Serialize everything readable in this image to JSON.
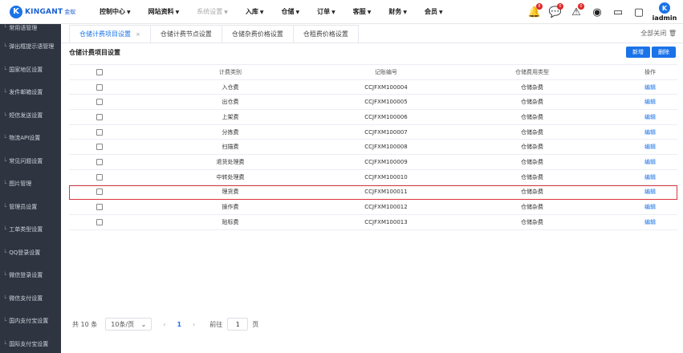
{
  "brand": {
    "mark": "K",
    "name": "KINGANT",
    "sub": "金蚁"
  },
  "menu": [
    {
      "label": "控制中心",
      "disabled": false
    },
    {
      "label": "网站资料",
      "disabled": false
    },
    {
      "label": "系统设置",
      "disabled": true
    },
    {
      "label": "入库",
      "disabled": false
    },
    {
      "label": "仓储",
      "disabled": false
    },
    {
      "label": "订单",
      "disabled": false
    },
    {
      "label": "客服",
      "disabled": false
    },
    {
      "label": "财务",
      "disabled": false
    },
    {
      "label": "会员",
      "disabled": false
    }
  ],
  "top_icons": [
    {
      "name": "bell-icon",
      "glyph": "🔔",
      "badge": "8"
    },
    {
      "name": "message-icon",
      "glyph": "💬",
      "badge": "0"
    },
    {
      "name": "alert-icon",
      "glyph": "⚠",
      "badge": "0"
    },
    {
      "name": "support-icon",
      "glyph": "◉",
      "badge": ""
    },
    {
      "name": "monitor-icon",
      "glyph": "▭",
      "badge": ""
    },
    {
      "name": "chat-icon",
      "glyph": "▢",
      "badge": ""
    }
  ],
  "user": {
    "avatar": "K",
    "name": "iadmin"
  },
  "sidebar": [
    "常用语管理",
    "弹出框提示语管理",
    "国家地区设置",
    "发件邮箱设置",
    "短信发送设置",
    "物流API设置",
    "常见问题设置",
    "图片管理",
    "管理员设置",
    "工单类型设置",
    "QQ登录设置",
    "微信登录设置",
    "微信支付设置",
    "国内支付宝设置",
    "国际支付宝设置"
  ],
  "tabs": [
    {
      "label": "仓储计费项目设置",
      "active": true,
      "closable": true
    },
    {
      "label": "仓储计费节点设置",
      "active": false,
      "closable": false
    },
    {
      "label": "仓储杂费价格设置",
      "active": false,
      "closable": false
    },
    {
      "label": "仓租费价格设置",
      "active": false,
      "closable": false
    }
  ],
  "close_all": "全部关闭",
  "panel": {
    "title": "仓储计费项目设置",
    "add_label": "新增",
    "delete_label": "删除"
  },
  "table": {
    "headers": {
      "type": "计费类别",
      "code": "记账编号",
      "category": "仓储费用类型",
      "op": "操作"
    },
    "rows": [
      {
        "type": "入仓费",
        "code": "CCJFXM100004",
        "category": "仓储杂费",
        "op": "编辑"
      },
      {
        "type": "出仓费",
        "code": "CCJFXM100005",
        "category": "仓储杂费",
        "op": "编辑"
      },
      {
        "type": "上架费",
        "code": "CCJFXM100006",
        "category": "仓储杂费",
        "op": "编辑"
      },
      {
        "type": "分拣费",
        "code": "CCJFXM100007",
        "category": "仓储杂费",
        "op": "编辑"
      },
      {
        "type": "扫描费",
        "code": "CCJFXM100008",
        "category": "仓储杂费",
        "op": "编辑"
      },
      {
        "type": "退货处理费",
        "code": "CCJFXM100009",
        "category": "仓储杂费",
        "op": "编辑"
      },
      {
        "type": "中转处理费",
        "code": "CCJFXM100010",
        "category": "仓储杂费",
        "op": "编辑"
      },
      {
        "type": "理货费",
        "code": "CCJFXM100011",
        "category": "仓储杂费",
        "op": "编辑",
        "highlighted": true
      },
      {
        "type": "操作费",
        "code": "CCJFXM100012",
        "category": "仓储杂费",
        "op": "编辑"
      },
      {
        "type": "贴标费",
        "code": "CCJFXM100013",
        "category": "仓储杂费",
        "op": "编辑"
      }
    ]
  },
  "pager": {
    "total": "共 10 条",
    "page_size": "10条/页",
    "current": "1",
    "goto_label": "前往",
    "goto_value": "1",
    "page_suffix": "页"
  }
}
